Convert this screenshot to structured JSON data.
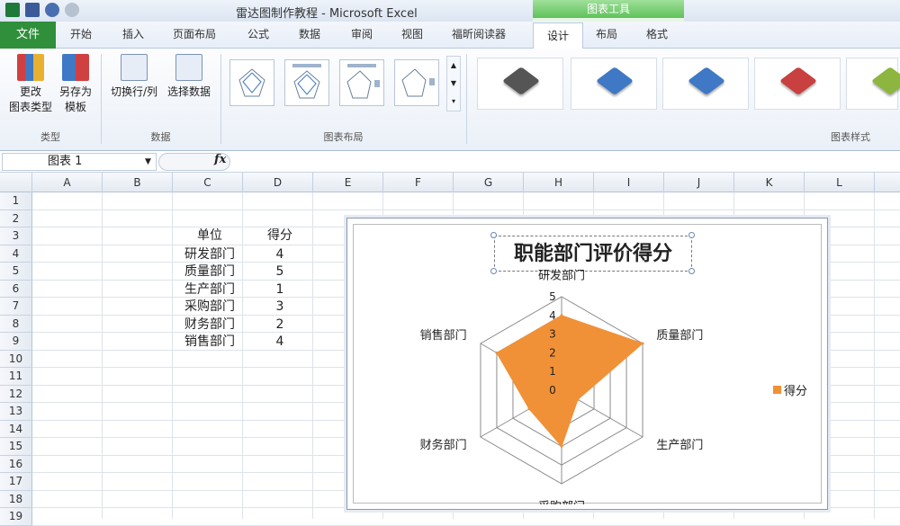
{
  "window": {
    "title": "雷达图制作教程 - Microsoft Excel"
  },
  "chart_tools_label": "图表工具",
  "tabs": {
    "file": "文件",
    "items": [
      "开始",
      "插入",
      "页面布局",
      "公式",
      "数据",
      "审阅",
      "视图",
      "福昕阅读器"
    ],
    "design": "设计",
    "layout": "布局",
    "format": "格式"
  },
  "ribbon": {
    "change_type": "更改\n图表类型",
    "change_type_line1": "更改",
    "change_type_line2": "图表类型",
    "save_template_line1": "另存为",
    "save_template_line2": "模板",
    "switch_rowcol": "切换行/列",
    "select_data": "选择数据",
    "group_type": "类型",
    "group_data": "数据",
    "group_layout": "图表布局",
    "group_styles": "图表样式",
    "style_colors": [
      "#555555",
      "#3f78c4",
      "#3f78c4",
      "#c84040",
      "#8cb640"
    ]
  },
  "formula": {
    "name_box": "图表 1",
    "fx": "fx"
  },
  "columns": [
    "A",
    "B",
    "C",
    "D",
    "E",
    "F",
    "G",
    "H",
    "I",
    "J",
    "K",
    "L"
  ],
  "rows": [
    "1",
    "2",
    "3",
    "4",
    "5",
    "6",
    "7",
    "8",
    "9",
    "10",
    "11",
    "12",
    "13",
    "14",
    "15",
    "16",
    "17",
    "18",
    "19"
  ],
  "table": {
    "header": {
      "unit": "单位",
      "score": "得分"
    },
    "rows": [
      {
        "unit": "研发部门",
        "score": "4"
      },
      {
        "unit": "质量部门",
        "score": "5"
      },
      {
        "unit": "生产部门",
        "score": "1"
      },
      {
        "unit": "采购部门",
        "score": "3"
      },
      {
        "unit": "财务部门",
        "score": "2"
      },
      {
        "unit": "销售部门",
        "score": "4"
      }
    ]
  },
  "chart_data": {
    "type": "radar",
    "title": "职能部门评价得分",
    "categories": [
      "研发部门",
      "质量部门",
      "生产部门",
      "采购部门",
      "财务部门",
      "销售部门"
    ],
    "series": [
      {
        "name": "得分",
        "values": [
          4,
          5,
          1,
          3,
          2,
          4
        ],
        "color": "#f09138"
      }
    ],
    "ticks": [
      "0",
      "1",
      "2",
      "3",
      "4",
      "5"
    ],
    "rlim": [
      0,
      5
    ],
    "legend": "right"
  }
}
